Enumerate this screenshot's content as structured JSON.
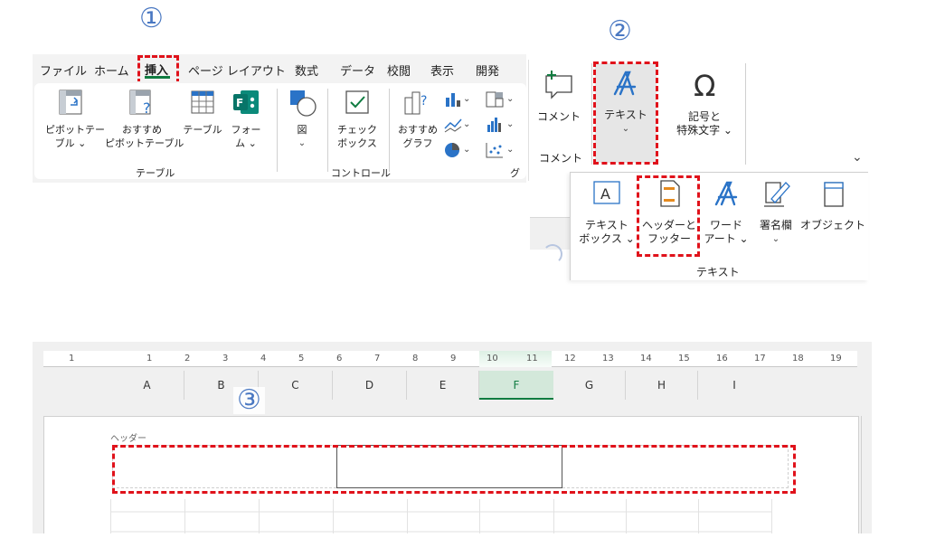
{
  "steps": {
    "one": "①",
    "two": "②",
    "three": "③"
  },
  "ribbon": {
    "tabs": [
      "ファイル",
      "ホーム",
      "挿入",
      "ページ レイアウト",
      "数式",
      "データ",
      "校閲",
      "表示",
      "開発"
    ],
    "active_tab": "挿入",
    "groups": {
      "table": {
        "label": "テーブル",
        "pivot": [
          "ピボットテー",
          "ブル ⌄"
        ],
        "recommended_pivot": [
          "おすすめ",
          "ピボットテーブル"
        ],
        "table": "テーブル",
        "form": [
          "フォー",
          "ム ⌄"
        ]
      },
      "illustration": {
        "figure": "図",
        "chevron": "⌄"
      },
      "control": {
        "label": "コントロール",
        "checkbox": [
          "チェック",
          "ボックス"
        ]
      },
      "chart": {
        "recommended": [
          "おすすめ",
          "グラフ"
        ],
        "cut_label": "グ"
      }
    }
  },
  "insert_panel": {
    "comment": {
      "label": "コメント",
      "group_label": "コメント"
    },
    "text": {
      "label": "テキスト",
      "chevron": "⌄"
    },
    "symbols": {
      "label": [
        "記号と",
        "特殊文字 ⌄"
      ]
    },
    "collapse": "⌄"
  },
  "text_dropdown": {
    "textbox": [
      "テキスト",
      "ボックス ⌄"
    ],
    "header_footer": [
      "ヘッダーと",
      "フッター"
    ],
    "wordart": [
      "ワード",
      "アート ⌄"
    ],
    "signature": [
      "署名欄",
      "⌄"
    ],
    "object": "オブジェクト",
    "group_label": "テキスト"
  },
  "sheet": {
    "ruler_numbers": [
      "1",
      "1",
      "2",
      "3",
      "4",
      "5",
      "6",
      "7",
      "8",
      "9",
      "10",
      "11",
      "12",
      "13",
      "14",
      "15",
      "16",
      "17",
      "18",
      "19"
    ],
    "columns": [
      "A",
      "B",
      "C",
      "D",
      "E",
      "F",
      "G",
      "H",
      "I"
    ],
    "selected_column": "F",
    "header_label": "ヘッダー"
  },
  "colors": {
    "accent_red": "#e0121b",
    "step_blue": "#4a78c2",
    "excel_green": "#107c41"
  }
}
